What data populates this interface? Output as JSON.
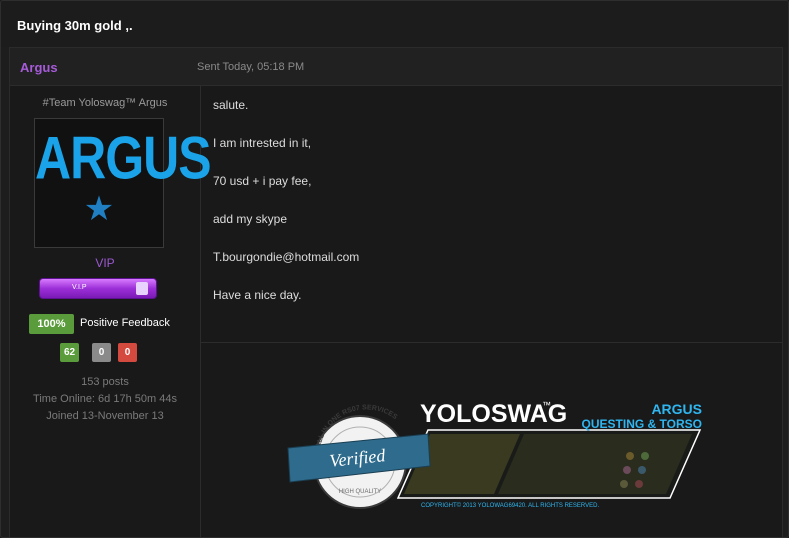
{
  "thread": {
    "title": "Buying 30m gold ,."
  },
  "post": {
    "author": "Argus",
    "date": "Sent Today, 05:18 PM",
    "body_lines": [
      "salute.",
      "I am intrested in it,",
      "70 usd + i pay fee,",
      "add my skype",
      "T.bourgondie@hotmail.com",
      "Have a nice day."
    ]
  },
  "author": {
    "user_title": "#Team Yoloswag™ Argus",
    "avatar_text": "ARGUS",
    "group": "VIP",
    "group_badge_label": "V.I.P",
    "feedback": {
      "percent": "100%",
      "label": "Positive Feedback",
      "positive": "62",
      "neutral": "0",
      "negative": "0"
    },
    "posts": "153 posts",
    "time_online": "Time Online: 6d 17h 50m 44s",
    "joined": "Joined 13-November 13"
  },
  "signature": {
    "seal_ring": "ALL IN ONE RS07 SERVICES",
    "seal_ribbon": "Verified",
    "seal_bottom": "HIGH QUALITY",
    "brand": "YOLOSWAG",
    "brand_mark": "™",
    "name": "ARGUS",
    "subtitle": "QUESTING & TORSO",
    "copyright": "COPYRIGHT© 2013 YOLOWAG69420. ALL RIGHTS RESERVED."
  },
  "colors": {
    "author_accent": "#a65bd8",
    "feedback_positive": "#5a9c3c",
    "feedback_neutral": "#8a8a8a",
    "feedback_negative": "#d44a3f",
    "avatar_blue": "#1aa3e8"
  },
  "icons": {
    "avatar_star": "star-icon",
    "badge_portrait": "portrait-icon"
  }
}
